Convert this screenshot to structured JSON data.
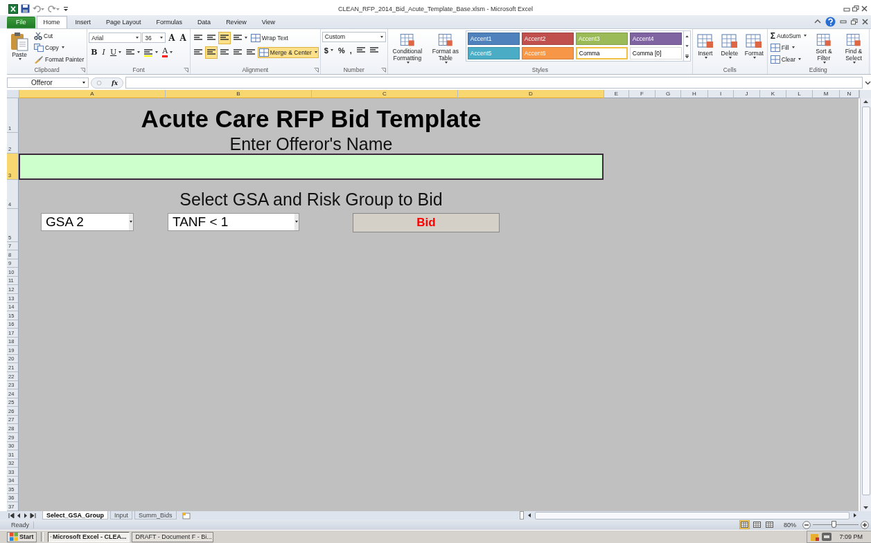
{
  "title_bar": {
    "title": "CLEAN_RFP_2014_Bid_Acute_Template_Base.xlsm  -  Microsoft Excel"
  },
  "ribbon": {
    "tabs": [
      {
        "label": "File",
        "kind": "file",
        "selected": false
      },
      {
        "label": "Home",
        "kind": "tab",
        "selected": true
      },
      {
        "label": "Insert",
        "kind": "tab",
        "selected": false
      },
      {
        "label": "Page Layout",
        "kind": "tab",
        "selected": false
      },
      {
        "label": "Formulas",
        "kind": "tab",
        "selected": false
      },
      {
        "label": "Data",
        "kind": "tab",
        "selected": false
      },
      {
        "label": "Review",
        "kind": "tab",
        "selected": false
      },
      {
        "label": "View",
        "kind": "tab",
        "selected": false
      }
    ],
    "groups": [
      {
        "label": "Clipboard",
        "launcher": true,
        "lines": [
          [
            {
              "kind": "big",
              "label": "Paste",
              "dropdown": true
            }
          ],
          [
            {
              "kind": "small",
              "label": "Cut",
              "dropdown": false
            },
            {
              "kind": "small",
              "label": "Copy",
              "dropdown": true
            },
            {
              "kind": "small",
              "label": "Format Painter",
              "dropdown": false
            }
          ]
        ]
      },
      {
        "label": "Font",
        "launcher": true,
        "lines": [
          [
            {
              "kind": "combo",
              "value": "Arial"
            },
            {
              "kind": "combo",
              "value": "36"
            },
            {
              "kind": "text",
              "label": "A",
              "dropdown": false
            },
            {
              "kind": "text",
              "label": "A",
              "dropdown": false
            }
          ],
          [
            {
              "kind": "text",
              "label": "B",
              "dropdown": false
            },
            {
              "kind": "text",
              "label": "I",
              "dropdown": false
            },
            {
              "kind": "text",
              "label": "U",
              "dropdown": true
            },
            {
              "kind": "icon",
              "dropdown": true,
              "selected": false
            },
            {
              "kind": "icon",
              "dropdown": true,
              "selected": false,
              "color": "#ffff00"
            },
            {
              "kind": "text",
              "label": "A",
              "dropdown": true,
              "color": "#ff0000"
            }
          ]
        ]
      },
      {
        "label": "Alignment",
        "launcher": true,
        "lines": [
          [
            {
              "kind": "icon",
              "dropdown": false,
              "selected": false
            },
            {
              "kind": "icon",
              "dropdown": false,
              "selected": false
            },
            {
              "kind": "icon",
              "dropdown": false,
              "selected": true
            },
            {
              "kind": "icon",
              "dropdown": true,
              "selected": false
            },
            {
              "kind": "small",
              "label": "Wrap Text",
              "dropdown": false,
              "selected": false
            }
          ],
          [
            {
              "kind": "icon",
              "dropdown": false,
              "selected": false
            },
            {
              "kind": "icon",
              "dropdown": false,
              "selected": true
            },
            {
              "kind": "icon",
              "dropdown": false,
              "selected": false
            },
            {
              "kind": "icon",
              "dropdown": false,
              "selected": false
            },
            {
              "kind": "icon",
              "dropdown": false,
              "selected": false
            },
            {
              "kind": "small",
              "label": "Merge & Center",
              "dropdown": true,
              "selected": true
            }
          ]
        ]
      },
      {
        "label": "Number",
        "launcher": true,
        "lines": [
          [
            {
              "kind": "combo",
              "value": "Custom"
            }
          ],
          [
            {
              "kind": "text",
              "label": "$",
              "dropdown": true
            },
            {
              "kind": "text",
              "label": "%",
              "dropdown": false
            },
            {
              "kind": "text",
              "label": ",",
              "dropdown": false
            },
            {
              "kind": "icon",
              "dropdown": false,
              "selected": false
            },
            {
              "kind": "icon",
              "dropdown": false,
              "selected": false
            }
          ]
        ]
      },
      {
        "label": "Styles",
        "launcher": false,
        "lines": [
          [
            {
              "kind": "big",
              "label": "Conditional Formatting",
              "dropdown": true
            }
          ],
          [
            {
              "kind": "big",
              "label": "Format as Table",
              "dropdown": true
            }
          ],
          [
            {
              "kind": "gallery",
              "styles": [
                {
                  "label": "Accent1",
                  "color": "#4f81bd",
                  "selected": false
                },
                {
                  "label": "Accent2",
                  "color": "#c0504d",
                  "selected": false
                },
                {
                  "label": "Accent3",
                  "color": "#9bbb59",
                  "selected": false
                },
                {
                  "label": "Accent4",
                  "color": "#8064a2",
                  "selected": false
                },
                {
                  "label": "Accent5",
                  "color": "#4bacc6",
                  "selected": false
                },
                {
                  "label": "Accent6",
                  "color": "#f79646",
                  "selected": false
                },
                {
                  "label": "Comma",
                  "color": "#ffffff",
                  "selected": true
                },
                {
                  "label": "Comma [0]",
                  "color": "#ffffff",
                  "selected": false
                }
              ]
            }
          ]
        ]
      },
      {
        "label": "Cells",
        "launcher": false,
        "lines": [
          [
            {
              "kind": "big",
              "label": "Insert",
              "dropdown": true
            }
          ],
          [
            {
              "kind": "big",
              "label": "Delete",
              "dropdown": true
            }
          ],
          [
            {
              "kind": "big",
              "label": "Format",
              "dropdown": true
            }
          ]
        ]
      },
      {
        "label": "Editing",
        "launcher": false,
        "lines": [
          [
            {
              "kind": "small",
              "label": "AutoSum",
              "glyph": "Σ",
              "dropdown": true
            },
            {
              "kind": "small",
              "label": "Fill",
              "dropdown": true
            },
            {
              "kind": "small",
              "label": "Clear",
              "dropdown": true
            }
          ],
          [
            {
              "kind": "big",
              "label": "Sort & Filter",
              "dropdown": true
            }
          ],
          [
            {
              "kind": "big",
              "label": "Find & Select",
              "dropdown": true
            }
          ]
        ]
      }
    ]
  },
  "formula_bar": {
    "name_box": "Offeror",
    "function_label": "fx"
  },
  "columns": [
    {
      "label": "A",
      "selected": true
    },
    {
      "label": "B",
      "selected": true
    },
    {
      "label": "C",
      "selected": true
    },
    {
      "label": "D",
      "selected": true
    },
    {
      "label": "E",
      "selected": false
    },
    {
      "label": "F",
      "selected": false
    },
    {
      "label": "G",
      "selected": false
    },
    {
      "label": "H",
      "selected": false
    },
    {
      "label": "I",
      "selected": false
    },
    {
      "label": "J",
      "selected": false
    },
    {
      "label": "K",
      "selected": false
    },
    {
      "label": "L",
      "selected": false
    },
    {
      "label": "M",
      "selected": false
    },
    {
      "label": "N",
      "selected": false
    }
  ],
  "rows": [
    {
      "label": "1",
      "selected": false
    },
    {
      "label": "2",
      "selected": false
    },
    {
      "label": "3",
      "selected": true
    },
    {
      "label": "4",
      "selected": false
    },
    {
      "label": "5",
      "selected": false
    },
    {
      "label": "7",
      "selected": false
    },
    {
      "label": "8",
      "selected": false
    },
    {
      "label": "9",
      "selected": false
    },
    {
      "label": "10",
      "selected": false
    },
    {
      "label": "11",
      "selected": false
    },
    {
      "label": "12",
      "selected": false
    },
    {
      "label": "13",
      "selected": false
    },
    {
      "label": "14",
      "selected": false
    },
    {
      "label": "15",
      "selected": false
    },
    {
      "label": "16",
      "selected": false
    },
    {
      "label": "17",
      "selected": false
    },
    {
      "label": "18",
      "selected": false
    },
    {
      "label": "19",
      "selected": false
    },
    {
      "label": "20",
      "selected": false
    },
    {
      "label": "21",
      "selected": false
    },
    {
      "label": "22",
      "selected": false
    },
    {
      "label": "23",
      "selected": false
    },
    {
      "label": "24",
      "selected": false
    },
    {
      "label": "25",
      "selected": false
    },
    {
      "label": "26",
      "selected": false
    },
    {
      "label": "27",
      "selected": false
    },
    {
      "label": "28",
      "selected": false
    },
    {
      "label": "29",
      "selected": false
    },
    {
      "label": "30",
      "selected": false
    },
    {
      "label": "31",
      "selected": false
    },
    {
      "label": "32",
      "selected": false
    },
    {
      "label": "33",
      "selected": false
    },
    {
      "label": "34",
      "selected": false
    },
    {
      "label": "35",
      "selected": false
    },
    {
      "label": "36",
      "selected": false
    },
    {
      "label": "37",
      "selected": false
    }
  ],
  "sheet": {
    "title": "Acute Care RFP Bid Template",
    "name_prompt": "Enter Offeror's Name",
    "select_prompt": "Select GSA and Risk Group to Bid",
    "dropdowns": [
      {
        "value": "GSA 2"
      },
      {
        "value": "TANF < 1"
      }
    ],
    "bid_button": "Bid"
  },
  "sheet_tabs": [
    {
      "label": "Select_GSA_Group",
      "selected": true
    },
    {
      "label": "Input",
      "selected": false
    },
    {
      "label": "Summ_Bids",
      "selected": false
    }
  ],
  "status_bar": {
    "status": "Ready",
    "views": [
      {
        "selected": true
      },
      {
        "selected": false
      },
      {
        "selected": false
      }
    ],
    "zoom": "80%",
    "zoom_level": {
      "level": 0.47
    }
  },
  "taskbar": {
    "start": "Start",
    "items": [
      {
        "label": "Microsoft Excel - CLEA...",
        "kind": "excel",
        "selected": true
      },
      {
        "label": "DRAFT - Document F - Bi...",
        "kind": "word",
        "selected": false
      }
    ],
    "clock": "7:09 PM"
  }
}
